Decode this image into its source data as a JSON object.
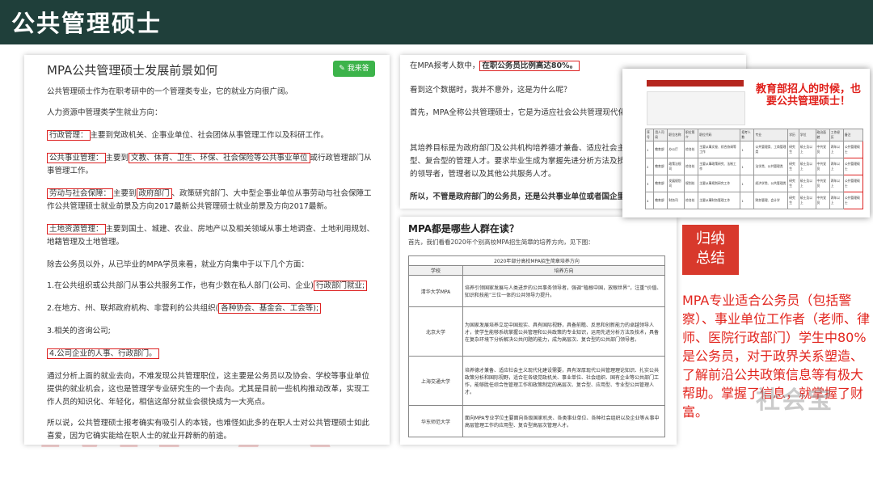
{
  "header": {
    "title": "公共管理硕士"
  },
  "watermark": "MPA",
  "left_doc": {
    "title": "MPA公共管理硕士发展前景如何",
    "answer_button": "我来答",
    "intro": "公共管理硕士作为在职考研中的一个管理类专业，它的就业方向很广阔。",
    "hr_line": "人力资源中管理类学生就业方向：",
    "items": [
      {
        "tag": "行政管理：",
        "text": "主要到党政机关、企事业单位、社会团体从事管理工作以及科研工作。"
      },
      {
        "tag": "公共事业管理：",
        "pre": "主要到",
        "boxed": "文教、体育、卫生、环保、社会保险等公共事业单位",
        "text": "或行政管理部门从事管理工作。"
      },
      {
        "tag": "劳动与社会保障：",
        "pre": "主要到",
        "boxed": "政府部门",
        "text": "、政策研究部门、大中型企事业单位从事劳动与社会保障工作公共管理硕士就业前景及方向2017最新公共管理硕士就业前景及方向2017最新。"
      },
      {
        "tag": "土地资源管理：",
        "text": "主要到国土、城建、农业、房地产以及相关领域从事土地调查、土地利用规划、地籍管理及土地管理。"
      }
    ],
    "civil_line": "除去公务员以外，从已毕业的MPA学员来看，就业方向集中于以下几个方面：",
    "list": [
      {
        "pre": "1.在公共组织或公共部门从事公共服务工作，也有少数在私人部门(公司、企业)",
        "boxed": "行政部门就业;",
        "post": ""
      },
      {
        "pre": "2.在地方、州、联邦政府机构、非营利的公共组织(",
        "boxed": "各种协会、基金会、工会等);",
        "post": ""
      },
      {
        "pre": "3.相关的咨询公司;",
        "boxed": "",
        "post": ""
      },
      {
        "pre": "",
        "boxed": "4.公司企业的人事、行政部门。",
        "post": ""
      }
    ],
    "analysis": "通过分析上面的就业去向，不难发现公共管理职位，这主要是公务员以及协会、学校等事业单位提供的就业机会，这也是管理学专业研究生的一个去向。尤其是目前一些机构推动改革，实现工作人员的知识化、年轻化，相信这部分就业会很快成为一大亮点。",
    "closing": "所以说，公共管理硕士报考确实有吸引人的本钱，也难怪如此多的在职人士对公共管理硕士如此喜爱，因为它确实能给在职人士的就业开辟新的前途。"
  },
  "top_doc": {
    "line1_pre": "在MPA报考人数中，",
    "line1_boxed": "在职公务员比例高达80%。",
    "line2": "看到这个数据时，我并不意外，这是为什么呢？",
    "line3": "首先，MPA全称公共管理硕士，它是为适应社会公共管理现代化、科学化和专业化需要而设立的。",
    "line4": "其培养目标是为政府部门及公共机构培养德才兼备、适应社会主义市场经济需要的高层次、应用型、复合型的管理人才。要求毕业生成为掌握先进分析方法及技术，胜任公共事务管理与政策分析的领导者，管理者以及其他公共服务人才。",
    "line5": "所以，不管是政府部门的公务员，还是公共事业单位或者国企里的"
  },
  "table_doc": {
    "title": "MPA都是哪些人群在读？",
    "subtitle": "首先，我们看看2020年个别高校MPA招生简章的培养方向，见下图：",
    "caption": "2020年部分高校MPA招生简章培养方向",
    "headers": [
      "学校",
      "培养方向"
    ],
    "rows": [
      {
        "school": "清华大学MPA",
        "text": "培养引领国家发展与人类进步的公共事务领导者，强调“植根中国，放眼世界”，注重“价值、知识和技能”三位一体的公共领导力提升。"
      },
      {
        "school": "北京大学",
        "text": "为国家发展培养立足中国现实、具有国际视野，具备前瞻、反思和创新能力的卓越领导人才，使学生能够系统掌握公共管理和公共政策的专业知识，运用先进分析方法及技术，具备在复杂环境下分析解决公共问题的能力，成为高层次、复合型的公共部门领导者。"
      },
      {
        "school": "上海交通大学",
        "text": "培养德才兼备、适应社会主义现代化建设需要，具有深厚现代公共管理理论知识、扎实公共政策分析和国际视野，适合在各级党政机关、事业单位、社会组织、国有企业等公共部门工作，能够胜任综合性管理工作和政策制定的高层次、复合型、应用型、专业型公共管理人才。"
      },
      {
        "school": "华东师范大学",
        "text": "面向MPA专业学位主要面向各级国家机关、各类事业单位、各种社会组织以及企业等从事中高层管理工作的应用型、复合型高层次管理人才。"
      }
    ]
  },
  "popup": {
    "red_text": "教育部招人的时候，也要公共管理硕士！",
    "headers": [
      "序号",
      "用人司局",
      "职位名称",
      "职位简介",
      "职位代码",
      "招考人数",
      "专业",
      "学历",
      "学位",
      "政治面貌",
      "工作经历",
      "备注"
    ],
    "rows": [
      [
        "教育部",
        "办公厅",
        "综合处",
        "主要从事文秘、综合协调等工作",
        "1",
        "公共管理类、工商管理类",
        "研究生",
        "硕士及以上",
        "中共党员",
        "两年以上",
        "公共管理硕士"
      ],
      [
        "教育部",
        "政策法规司",
        "综合处",
        "主要从事政策研究、法制工作",
        "1",
        "法学类、公共管理类",
        "研究生",
        "硕士及以上",
        "中共党员",
        "两年以上",
        "公共管理硕士"
      ],
      [
        "教育部",
        "发展规划司",
        "规划处",
        "主要从事规划研究工作",
        "1",
        "经济学类、公共管理类",
        "研究生",
        "硕士及以上",
        "中共党员",
        "两年以上",
        "公共管理硕士"
      ],
      [
        "教育部",
        "财务司",
        "综合处",
        "主要从事财务管理工作",
        "1",
        "财务管理、会计学",
        "研究生",
        "硕士及以上",
        "中共党员",
        "两年以上",
        "公共管理硕士"
      ]
    ]
  },
  "summary": {
    "label_line1": "归纳",
    "label_line2": "总结",
    "description": "MPA专业适合公务员（包括警察）、事业单位工作者（老师、律师、医院行政部门）学生中80%是公务员，对于政界关系塑造、了解前沿公共政策信息等有极大帮助。掌握了信息，就掌握了财富。"
  },
  "brand": "社会宝",
  "colors": {
    "header_bg": "#1f3f3a",
    "accent_red": "#e2261f",
    "button_green": "#3cb34a"
  }
}
